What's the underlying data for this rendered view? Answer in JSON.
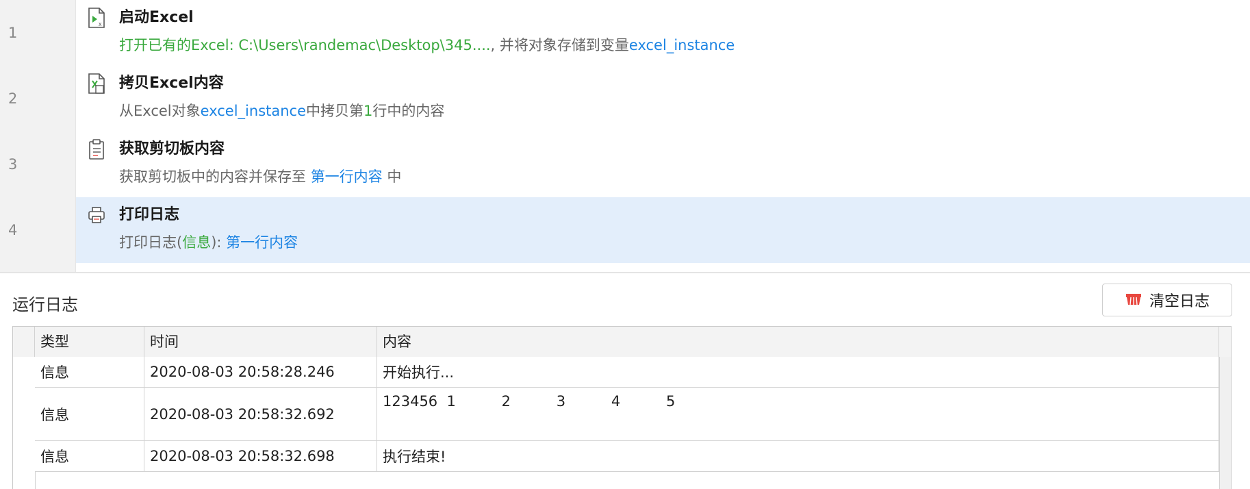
{
  "flow": {
    "steps": [
      {
        "line": "1",
        "icon": "excel-launch-icon",
        "title": "启动Excel",
        "desc": [
          {
            "text": "打开已有的Excel: C:\\Users\\randemac\\Desktop\\345....",
            "color": "green"
          },
          {
            "text": ", 并将对象存储到变量",
            "color": "gray"
          },
          {
            "text": "excel_instance",
            "color": "blue"
          }
        ]
      },
      {
        "line": "2",
        "icon": "excel-copy-icon",
        "title": "拷贝Excel内容",
        "desc": [
          {
            "text": "从Excel对象",
            "color": "gray"
          },
          {
            "text": "excel_instance",
            "color": "blue"
          },
          {
            "text": "中拷贝第",
            "color": "gray"
          },
          {
            "text": "1",
            "color": "green"
          },
          {
            "text": "行中的内容",
            "color": "gray"
          }
        ]
      },
      {
        "line": "3",
        "icon": "clipboard-icon",
        "title": "获取剪切板内容",
        "desc": [
          {
            "text": "获取剪切板中的内容并保存至 ",
            "color": "gray"
          },
          {
            "text": "第一行内容",
            "color": "blue"
          },
          {
            "text": " 中",
            "color": "gray"
          }
        ]
      },
      {
        "line": "4",
        "icon": "print-log-icon",
        "title": "打印日志",
        "selected": true,
        "desc": [
          {
            "text": "打印日志(",
            "color": "gray"
          },
          {
            "text": "信息",
            "color": "green"
          },
          {
            "text": "): ",
            "color": "gray"
          },
          {
            "text": "第一行内容",
            "color": "blue"
          }
        ]
      }
    ]
  },
  "log": {
    "title": "运行日志",
    "clear_label": "清空日志",
    "columns": [
      "类型",
      "时间",
      "内容"
    ],
    "rows": [
      {
        "type": "信息",
        "time": "2020-08-03 20:58:28.246",
        "content": "开始执行..."
      },
      {
        "type": "信息",
        "time": "2020-08-03 20:58:32.692",
        "content": "123456  1          2          3          4          5"
      },
      {
        "type": "信息",
        "time": "2020-08-03 20:58:32.698",
        "content": "执行结束!"
      }
    ]
  },
  "colors": {
    "green": "#3aa93e",
    "blue": "#1d84e3",
    "gray": "#666666",
    "selected_bg": "#e3eefb",
    "clear_icon": "#e8473f"
  }
}
